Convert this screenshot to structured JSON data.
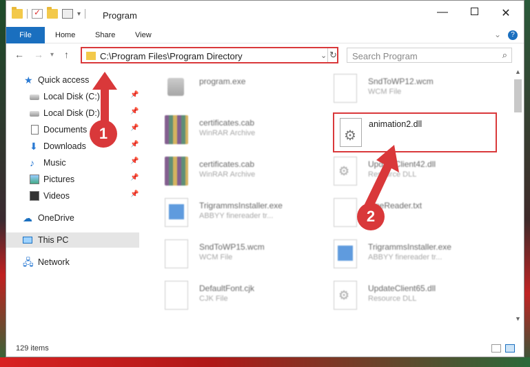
{
  "window": {
    "title": "Program",
    "controls": {
      "minimize": "—",
      "maximize": "",
      "close": "✕"
    }
  },
  "ribbon": {
    "tabs": [
      "File",
      "Home",
      "Share",
      "View"
    ]
  },
  "address": {
    "path": "C:\\Program Files\\Program Directory",
    "search_placeholder": "Search Program"
  },
  "sidebar": {
    "items": [
      {
        "label": "Quick access",
        "icon": "star-icon"
      },
      {
        "label": "Local Disk (C:)",
        "icon": "disk-icon",
        "pinned": true
      },
      {
        "label": "Local Disk (D:)",
        "icon": "disk-icon",
        "pinned": true
      },
      {
        "label": "Documents",
        "icon": "documents-icon",
        "pinned": true
      },
      {
        "label": "Downloads",
        "icon": "download-icon",
        "pinned": true
      },
      {
        "label": "Music",
        "icon": "music-icon",
        "pinned": true
      },
      {
        "label": "Pictures",
        "icon": "pictures-icon",
        "pinned": true
      },
      {
        "label": "Videos",
        "icon": "videos-icon",
        "pinned": true
      },
      {
        "label": "OneDrive",
        "icon": "cloud-icon"
      },
      {
        "label": "This PC",
        "icon": "computer-icon",
        "active": true
      },
      {
        "label": "Network",
        "icon": "network-icon"
      }
    ]
  },
  "files": [
    {
      "name": "program.exe",
      "type": "",
      "icon": "exe-icon"
    },
    {
      "name": "SndToWP12.wcm",
      "type": "WCM File",
      "icon": "file-icon"
    },
    {
      "name": "certificates.cab",
      "type": "WinRAR Archive",
      "icon": "archive-icon"
    },
    {
      "name": "animation2.dll",
      "type": "",
      "icon": "dll-icon",
      "highlighted": true
    },
    {
      "name": "certificates.cab",
      "type": "WinRAR Archive",
      "icon": "archive-icon"
    },
    {
      "name": "UpdateClient42.dll",
      "type": "Resource DLL",
      "icon": "dll-icon"
    },
    {
      "name": "TrigrammsInstaller.exe",
      "type": "ABBYY finereader tr...",
      "icon": "app-icon"
    },
    {
      "name": "FineReader.txt",
      "type": "",
      "icon": "file-icon"
    },
    {
      "name": "SndToWP15.wcm",
      "type": "WCM File",
      "icon": "file-icon"
    },
    {
      "name": "TrigrammsInstaller.exe",
      "type": "ABBYY finereader tr...",
      "icon": "app-icon"
    },
    {
      "name": "DefaultFont.cjk",
      "type": "CJK File",
      "icon": "file-icon"
    },
    {
      "name": "UpdateClient65.dll",
      "type": "Resource DLL",
      "icon": "dll-icon"
    }
  ],
  "status": {
    "item_count": "129 items"
  },
  "annotations": {
    "step1": "1",
    "step2": "2"
  },
  "colors": {
    "accent": "#1a6fbf",
    "highlight": "#d9383a"
  }
}
